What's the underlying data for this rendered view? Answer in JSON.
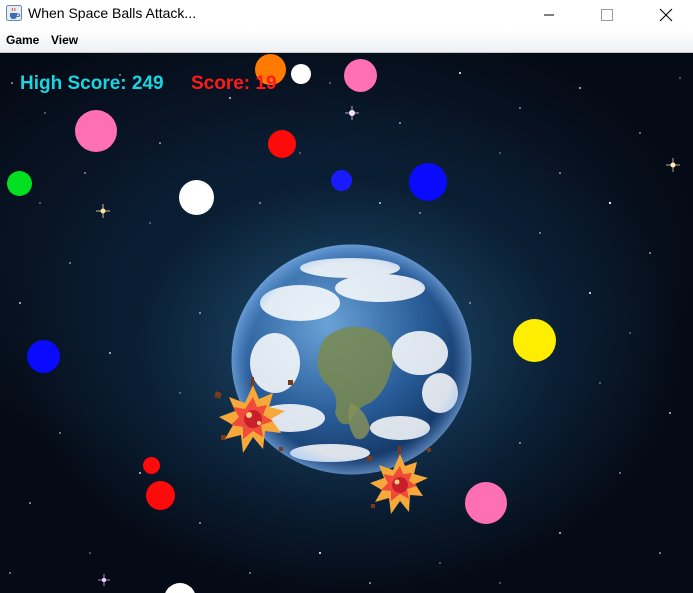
{
  "window": {
    "title": "When Space Balls Attack...",
    "icon": "java-coffee-icon",
    "controls": [
      "minimize-icon",
      "maximize-icon",
      "close-icon"
    ]
  },
  "menu": {
    "game_label": "Game",
    "view_label": "View"
  },
  "hud": {
    "high_score_text": "High Score: 249",
    "score_text": "Score: 19",
    "high_score_color": "#1ed3e0",
    "score_color": "#ff1a1a"
  },
  "scene": {
    "background": "starfield",
    "planet": "earth",
    "explosion_count": 2,
    "ball_colors": [
      "#ff6fb4",
      "#ff0a0a",
      "#1a1aff",
      "#00e020",
      "#ffffff",
      "#ffee00",
      "#ff7a00"
    ]
  }
}
